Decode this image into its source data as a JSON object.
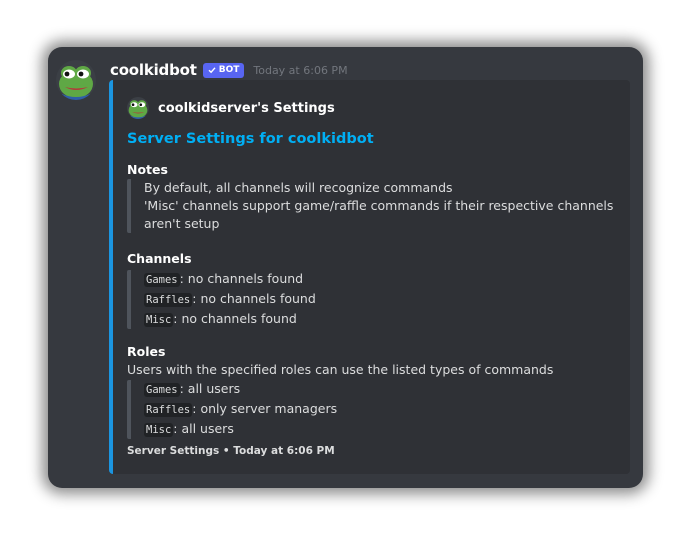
{
  "message": {
    "username": "coolkidbot",
    "bot_tag": "BOT",
    "timestamp": "Today at 6:06 PM",
    "avatar_icon": "pepe-frog-icon"
  },
  "embed": {
    "accent_color": "#1b95e0",
    "author": "coolkidserver's Settings",
    "title": "Server Settings for coolkidbot",
    "notes": {
      "name": "Notes",
      "lines": [
        "By default, all channels will recognize commands",
        "'Misc' channels support game/raffle commands if their respective channels",
        "aren't setup"
      ]
    },
    "channels": {
      "name": "Channels",
      "items": [
        {
          "code": "Games",
          "text": ": no channels found"
        },
        {
          "code": "Raffles",
          "text": ": no channels found"
        },
        {
          "code": "Misc",
          "text": ": no channels found"
        }
      ]
    },
    "roles": {
      "name": "Roles",
      "description": "Users with the specified roles can use the listed types of commands",
      "items": [
        {
          "code": "Games",
          "text": ": all users"
        },
        {
          "code": "Raffles",
          "text": ": only server managers"
        },
        {
          "code": "Misc",
          "text": ": all users"
        }
      ]
    },
    "footer": "Server Settings • Today at 6:06 PM"
  }
}
